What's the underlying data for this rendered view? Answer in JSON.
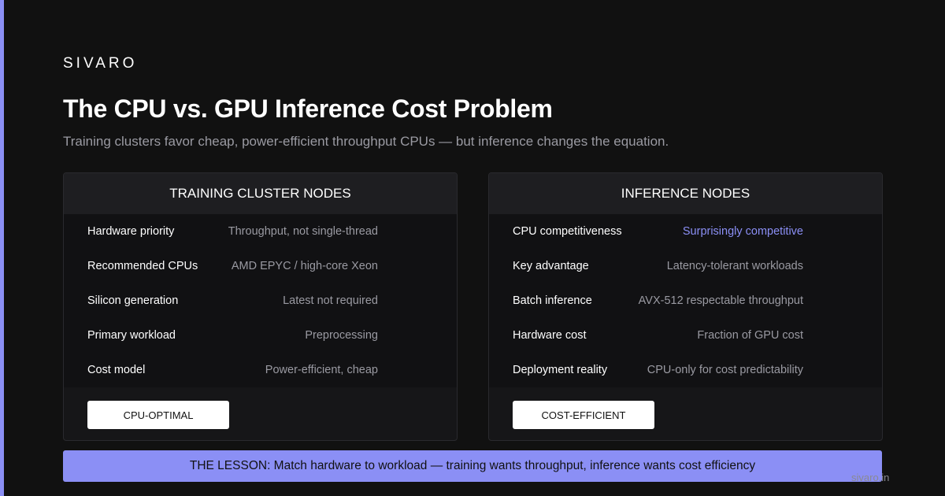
{
  "brand": "SIVARO",
  "title": "The CPU vs. GPU Inference Cost Problem",
  "subtitle": "Training clusters favor cheap, power-efficient throughput CPUs — but inference changes the equation.",
  "colors": {
    "accent": "#8b8ff5",
    "background": "#111111"
  },
  "cards": {
    "training": {
      "header": "TRAINING CLUSTER NODES",
      "rows": [
        {
          "label": "Hardware priority",
          "value": "Throughput, not single-thread"
        },
        {
          "label": "Recommended CPUs",
          "value": "AMD EPYC / high-core Xeon"
        },
        {
          "label": "Silicon generation",
          "value": "Latest not required"
        },
        {
          "label": "Primary workload",
          "value": "Preprocessing"
        },
        {
          "label": "Cost model",
          "value": "Power-efficient, cheap"
        }
      ],
      "badge": "CPU-OPTIMAL"
    },
    "inference": {
      "header": "INFERENCE NODES",
      "rows": [
        {
          "label": "CPU competitiveness",
          "value": "Surprisingly competitive"
        },
        {
          "label": "Key advantage",
          "value": "Latency-tolerant workloads"
        },
        {
          "label": "Batch inference",
          "value": "AVX-512 respectable throughput"
        },
        {
          "label": "Hardware cost",
          "value": "Fraction of GPU cost"
        },
        {
          "label": "Deployment reality",
          "value": "CPU-only for cost predictability"
        }
      ],
      "badge": "COST-EFFICIENT"
    }
  },
  "lesson": "THE LESSON: Match hardware to workload — training wants throughput, inference wants cost efficiency",
  "footer": "sivaro.in"
}
